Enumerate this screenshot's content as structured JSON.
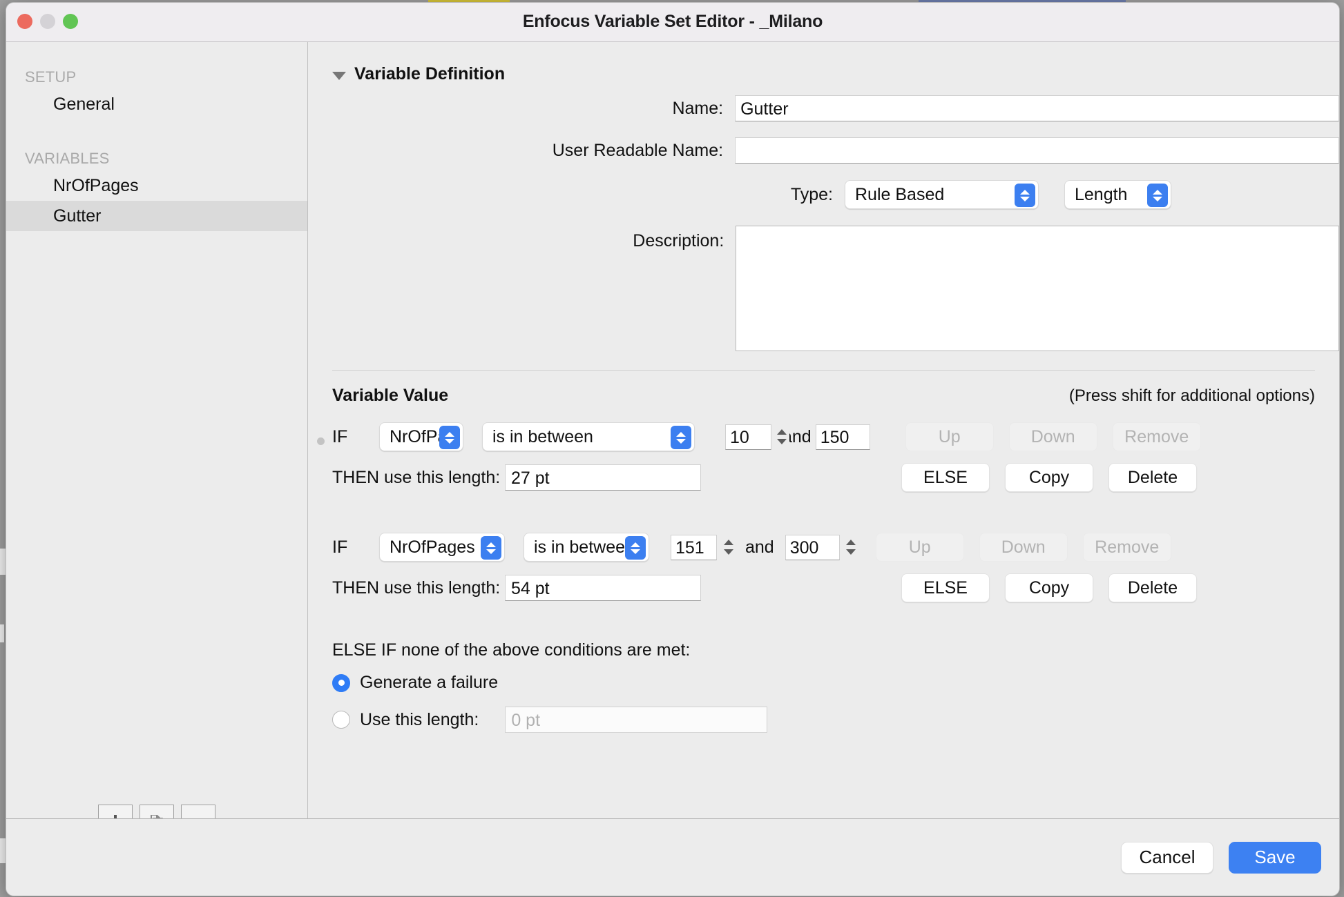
{
  "window": {
    "title": "Enfocus Variable Set Editor - _Milano",
    "traffic_lights": [
      "close",
      "minimize",
      "zoom"
    ]
  },
  "sidebar": {
    "groups": [
      {
        "label": "SETUP",
        "items": [
          {
            "label": "General",
            "selected": false
          }
        ]
      },
      {
        "label": "VARIABLES",
        "items": [
          {
            "label": "NrOfPages",
            "selected": false
          },
          {
            "label": "Gutter",
            "selected": true
          }
        ]
      }
    ],
    "toolbar": {
      "add_label": "+",
      "duplicate_label": "duplicate",
      "remove_label": "−"
    }
  },
  "definition": {
    "section_title": "Variable Definition",
    "name_label": "Name:",
    "name_value": "Gutter",
    "user_readable_label": "User Readable Name:",
    "user_readable_value": "",
    "type_label": "Type:",
    "type_value": "Rule Based",
    "datatype_value": "Length",
    "description_label": "Description:",
    "description_value": ""
  },
  "variable_value": {
    "section_title": "Variable Value",
    "hint": "(Press shift for additional options)",
    "if_label": "IF",
    "then_label": "THEN use this length:",
    "and_label": "and",
    "rules": [
      {
        "variable": "NrOfPages",
        "variable_display": "NrOfPa",
        "operator": "is in between",
        "value_from": "10",
        "value_to": "150",
        "then_length": "27 pt",
        "up_label": "Up",
        "down_label": "Down",
        "remove_label": "Remove",
        "else_label": "ELSE",
        "copy_label": "Copy",
        "delete_label": "Delete",
        "up_enabled": false,
        "down_enabled": false,
        "remove_enabled": false
      },
      {
        "variable": "NrOfPages",
        "variable_display": "NrOfPages",
        "operator": "is in between",
        "value_from": "151",
        "value_to": "300",
        "then_length": "54 pt",
        "up_label": "Up",
        "down_label": "Down",
        "remove_label": "Remove",
        "else_label": "ELSE",
        "copy_label": "Copy",
        "delete_label": "Delete",
        "up_enabled": false,
        "down_enabled": false,
        "remove_enabled": false
      }
    ],
    "fallback": {
      "title": "ELSE IF none of the above conditions are met:",
      "option_failure": "Generate a failure",
      "option_length": "Use this length:",
      "length_placeholder": "0 pt",
      "selected": "failure"
    }
  },
  "footer": {
    "cancel_label": "Cancel",
    "save_label": "Save"
  },
  "colors": {
    "accent": "#3d81f2",
    "stepper_blue": "#3c7ff0",
    "window_bg": "#ececec",
    "titlebar_bg": "#efedf0",
    "selected_row": "#dadada"
  }
}
